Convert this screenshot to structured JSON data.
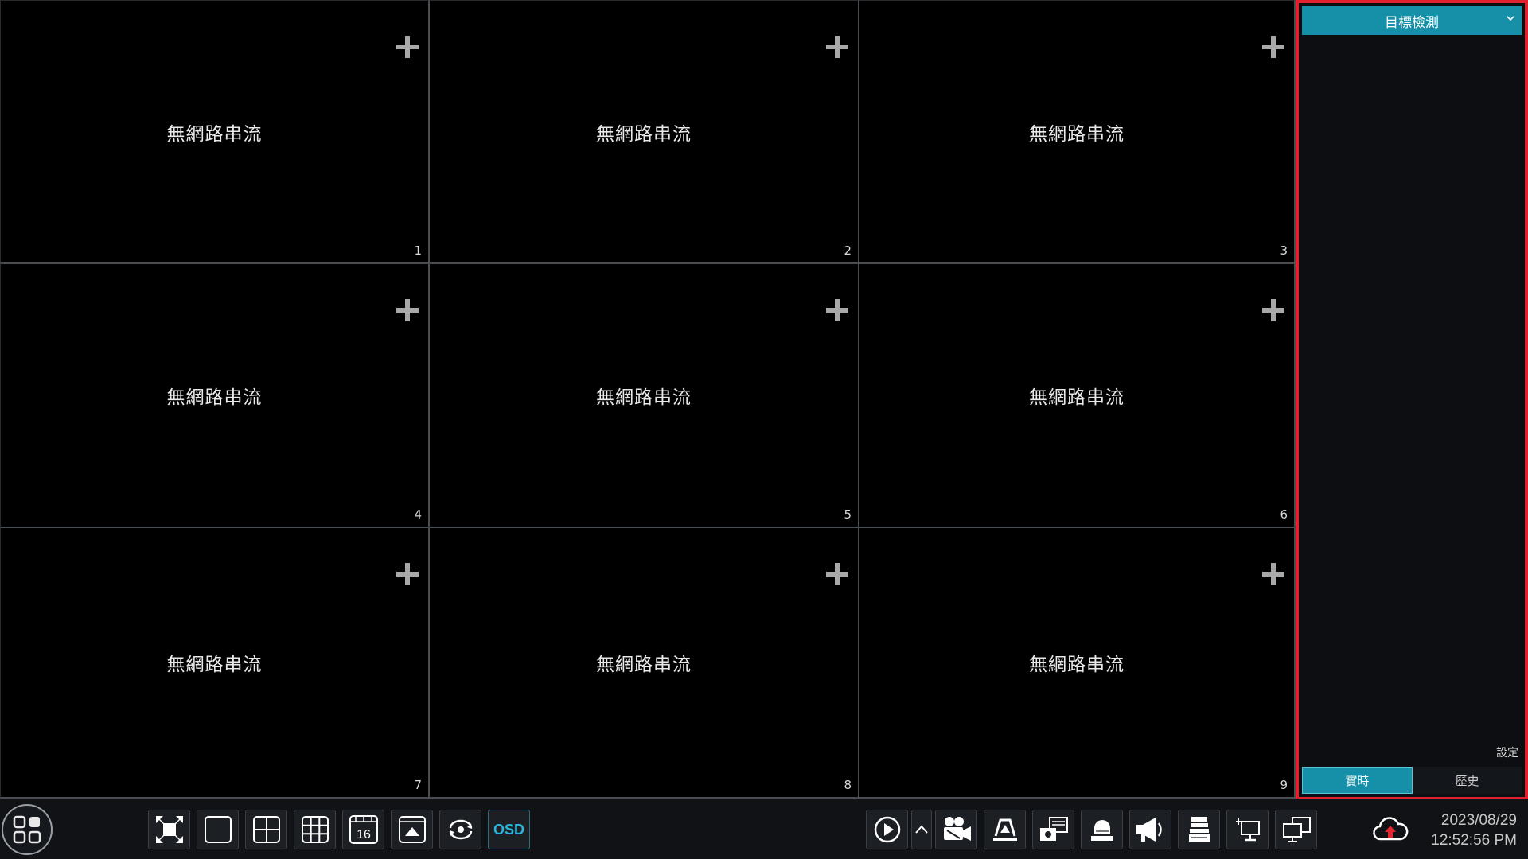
{
  "grid": {
    "no_stream_text": "無網路串流",
    "channels": [
      {
        "number": "1"
      },
      {
        "number": "2"
      },
      {
        "number": "3"
      },
      {
        "number": "4"
      },
      {
        "number": "5"
      },
      {
        "number": "6"
      },
      {
        "number": "7"
      },
      {
        "number": "8"
      },
      {
        "number": "9"
      }
    ]
  },
  "panel": {
    "title": "目標檢測",
    "settings_label": "設定",
    "tabs": [
      {
        "label": "實時",
        "active": true
      },
      {
        "label": "歷史",
        "active": false
      }
    ],
    "header_color": "#1690a8",
    "highlight_border_color": "#e0202c"
  },
  "toolbar": {
    "layout_16_label": "16",
    "osd_label": "OSD",
    "icons": [
      "main-menu-icon",
      "fullscreen-icon",
      "single-view-icon",
      "quad-view-icon",
      "nine-view-icon",
      "sixteen-view-icon",
      "pip-view-icon",
      "sequence-icon",
      "osd-icon",
      "playback-icon",
      "expand-up-icon",
      "record-icon",
      "snapshot-icon",
      "e-zoom-icon",
      "alarm-light-icon",
      "audio-broadcast-icon",
      "disk-icon",
      "network-icon",
      "display-output-icon",
      "cloud-upgrade-icon"
    ],
    "accent_color": "#27b6d8"
  },
  "clock": {
    "date": "2023/08/29",
    "time": "12:52:56 PM"
  }
}
